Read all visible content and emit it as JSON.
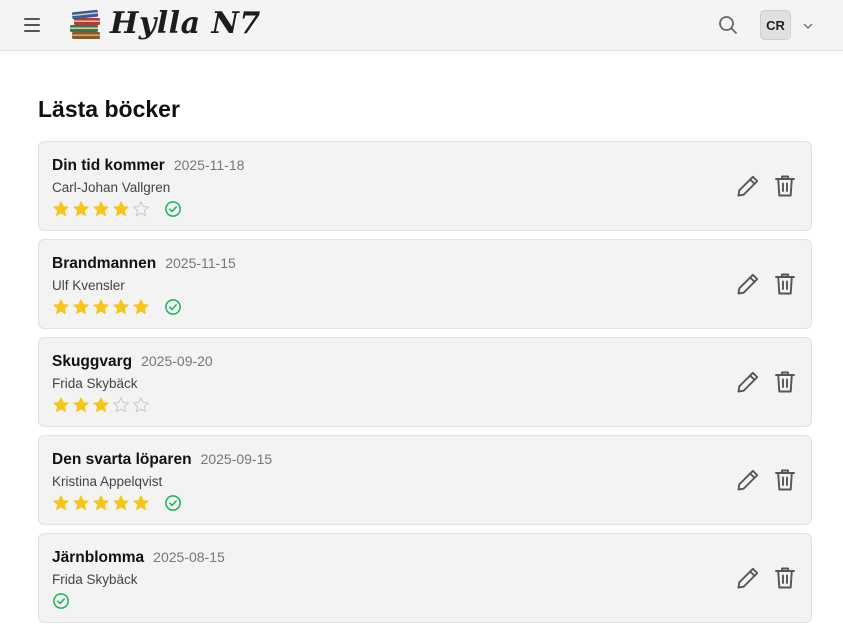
{
  "header": {
    "app_title": "Hylla N7",
    "user_initials": "CR"
  },
  "page": {
    "title": "Lästa böcker"
  },
  "colors": {
    "star": "#f5c518",
    "star_empty": "#c8c8c8",
    "read_check": "#19b35c",
    "icon": "#555555"
  },
  "books": [
    {
      "title": "Din tid kommer",
      "date": "2025-11-18",
      "author": "Carl-Johan Vallgren",
      "rating": 4,
      "max_rating": 5,
      "read": true
    },
    {
      "title": "Brandmannen",
      "date": "2025-11-15",
      "author": "Ulf Kvensler",
      "rating": 5,
      "max_rating": 5,
      "read": true
    },
    {
      "title": "Skuggvarg",
      "date": "2025-09-20",
      "author": "Frida Skybäck",
      "rating": 3,
      "max_rating": 5,
      "read": false
    },
    {
      "title": "Den svarta löparen",
      "date": "2025-09-15",
      "author": "Kristina Appelqvist",
      "rating": 5,
      "max_rating": 5,
      "read": true
    },
    {
      "title": "Järnblomma",
      "date": "2025-08-15",
      "author": "Frida Skybäck",
      "rating": null,
      "max_rating": 5,
      "read": true
    }
  ]
}
